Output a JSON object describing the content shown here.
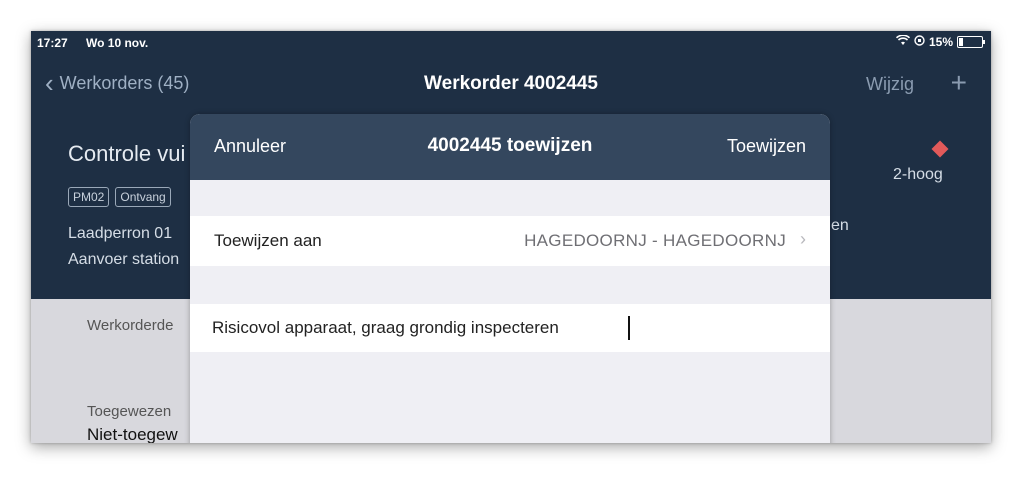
{
  "status_bar": {
    "time": "17:27",
    "date": "Wo 10 nov.",
    "battery": "15%"
  },
  "nav": {
    "back_label": "Werkorders (45)",
    "title": "Werkorder 4002445",
    "edit_label": "Wijzig",
    "add_label": "+"
  },
  "workorder": {
    "title": "Controle vui",
    "tags": [
      "PM02",
      "Ontvang"
    ],
    "location_line1": "Laadperron 01",
    "location_line2": "Aanvoer station",
    "right_fragment": "en",
    "priority": "2-hoog",
    "priority_color": "#e25a5a"
  },
  "details": {
    "label1": "Werkorderde",
    "label2": "Toegewezen",
    "value2": "Niet-toegew"
  },
  "modal": {
    "cancel_label": "Annuleer",
    "title": "4002445 toewijzen",
    "confirm_label": "Toewijzen",
    "assign_label": "Toewijzen aan",
    "assign_value": "HAGEDOORNJ -  HAGEDOORNJ",
    "note_value": "Risicovol apparaat, graag grondig inspecteren"
  }
}
